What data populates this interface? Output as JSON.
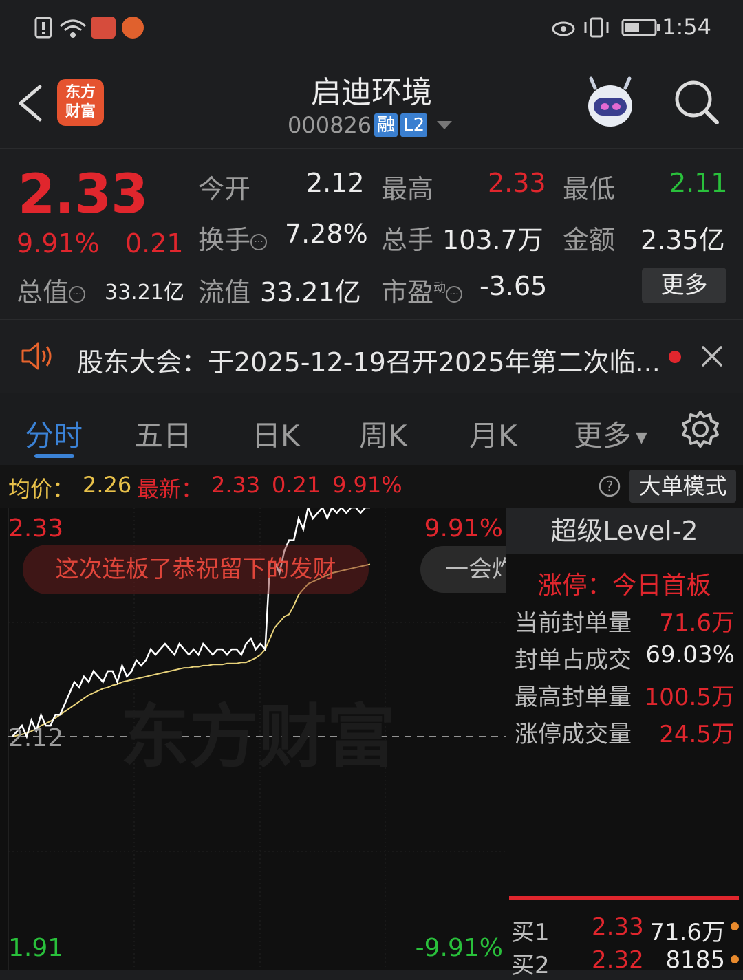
{
  "status_bar": {
    "time": "1:54"
  },
  "header": {
    "logo_line1": "东方",
    "logo_line2": "财富",
    "stock_name": "启迪环境",
    "stock_code": "000826",
    "tag_margin": "融",
    "tag_level": "L2"
  },
  "quote": {
    "price": "2.33",
    "change_pct": "9.91%",
    "change_abs": "0.21",
    "open_label": "今开",
    "open_value": "2.12",
    "high_label": "最高",
    "high_value": "2.33",
    "low_label": "最低",
    "low_value": "2.11",
    "turnover_label": "换手",
    "turnover_value": "7.28%",
    "volume_label": "总手",
    "volume_value": "103.7万",
    "amount_label": "金额",
    "amount_value": "2.35亿",
    "mktcap_label": "总值",
    "mktcap_value": "33.21亿",
    "float_label": "流值",
    "float_value": "33.21亿",
    "pe_label": "市盈",
    "pe_superscript": "动",
    "pe_value": "-3.65",
    "more_button": "更多"
  },
  "notice": {
    "text": "股东大会：于2025-12-19召开2025年第二次临..."
  },
  "tabs": [
    "分时",
    "五日",
    "日K",
    "周K",
    "月K",
    "更多"
  ],
  "chart_header": {
    "avg_label": "均价：",
    "avg_value": "2.26",
    "latest_label": "最新：",
    "latest_value": "2.33",
    "latest_change": "0.21",
    "latest_pct": "9.91%",
    "mode_button": "大单模式"
  },
  "chart_data": {
    "type": "line",
    "title": "",
    "y_labels": {
      "top": "2.33",
      "base": "2.12",
      "bottom": "1.91"
    },
    "pct_labels": {
      "top": "9.91%",
      "bottom": "-9.91%"
    },
    "ylim": [
      1.91,
      2.33
    ],
    "prev_close": 2.12,
    "watermark": "东方财富",
    "series": [
      {
        "name": "",
        "color": "#ffffff",
        "values": [
          2.12,
          2.125,
          2.13,
          2.12,
          2.135,
          2.125,
          2.14,
          2.13,
          2.13,
          2.14,
          2.14,
          2.15,
          2.16,
          2.17,
          2.165,
          2.175,
          2.17,
          2.18,
          2.175,
          2.17,
          2.18,
          2.18,
          2.17,
          2.185,
          2.175,
          2.18,
          2.19,
          2.185,
          2.19,
          2.2,
          2.195,
          2.2,
          2.205,
          2.2,
          2.195,
          2.205,
          2.2,
          2.195,
          2.2,
          2.195,
          2.205,
          2.2,
          2.195,
          2.2,
          2.2,
          2.195,
          2.2,
          2.2,
          2.195,
          2.205,
          2.21,
          2.2,
          2.205,
          2.2,
          2.28,
          2.28,
          2.27,
          2.29,
          2.3,
          2.3,
          2.32,
          2.31,
          2.33,
          2.32,
          2.325,
          2.33,
          2.32,
          2.33,
          2.325,
          2.33,
          2.325,
          2.33,
          2.33,
          2.325,
          2.33,
          2.33
        ]
      },
      {
        "name": "",
        "color": "#e8d27a",
        "values": [
          2.12,
          2.121,
          2.122,
          2.123,
          2.125,
          2.127,
          2.13,
          2.132,
          2.134,
          2.137,
          2.14,
          2.143,
          2.146,
          2.149,
          2.152,
          2.155,
          2.158,
          2.16,
          2.162,
          2.164,
          2.165,
          2.167,
          2.168,
          2.17,
          2.171,
          2.172,
          2.173,
          2.174,
          2.175,
          2.176,
          2.177,
          2.178,
          2.179,
          2.18,
          2.181,
          2.182,
          2.183,
          2.183,
          2.184,
          2.184,
          2.185,
          2.185,
          2.186,
          2.186,
          2.186,
          2.187,
          2.187,
          2.187,
          2.188,
          2.188,
          2.19,
          2.192,
          2.195,
          2.2,
          2.21,
          2.22,
          2.225,
          2.23,
          2.232,
          2.24,
          2.25,
          2.255,
          2.26,
          2.262,
          2.264,
          2.266,
          2.268,
          2.27,
          2.271,
          2.272,
          2.273,
          2.274,
          2.275,
          2.276,
          2.277,
          2.278
        ]
      }
    ],
    "bubbles": [
      "这次连板了恭祝留下的发财",
      "一会炸"
    ]
  },
  "level2": {
    "title": "超级Level-2",
    "limit_up": "涨停：今日首板",
    "rows": [
      {
        "label": "当前封单量",
        "value": "71.6万",
        "color": "#e0262d"
      },
      {
        "label": "封单占成交",
        "value": "69.03%",
        "color": "#ececec"
      },
      {
        "label": "最高封单量",
        "value": "100.5万",
        "color": "#e0262d"
      },
      {
        "label": "涨停成交量",
        "value": "24.5万",
        "color": "#e0262d"
      }
    ],
    "bids": [
      {
        "label": "买1",
        "price": "2.33",
        "volume": "71.6万"
      },
      {
        "label": "买2",
        "price": "2.32",
        "volume": "8185"
      }
    ]
  }
}
